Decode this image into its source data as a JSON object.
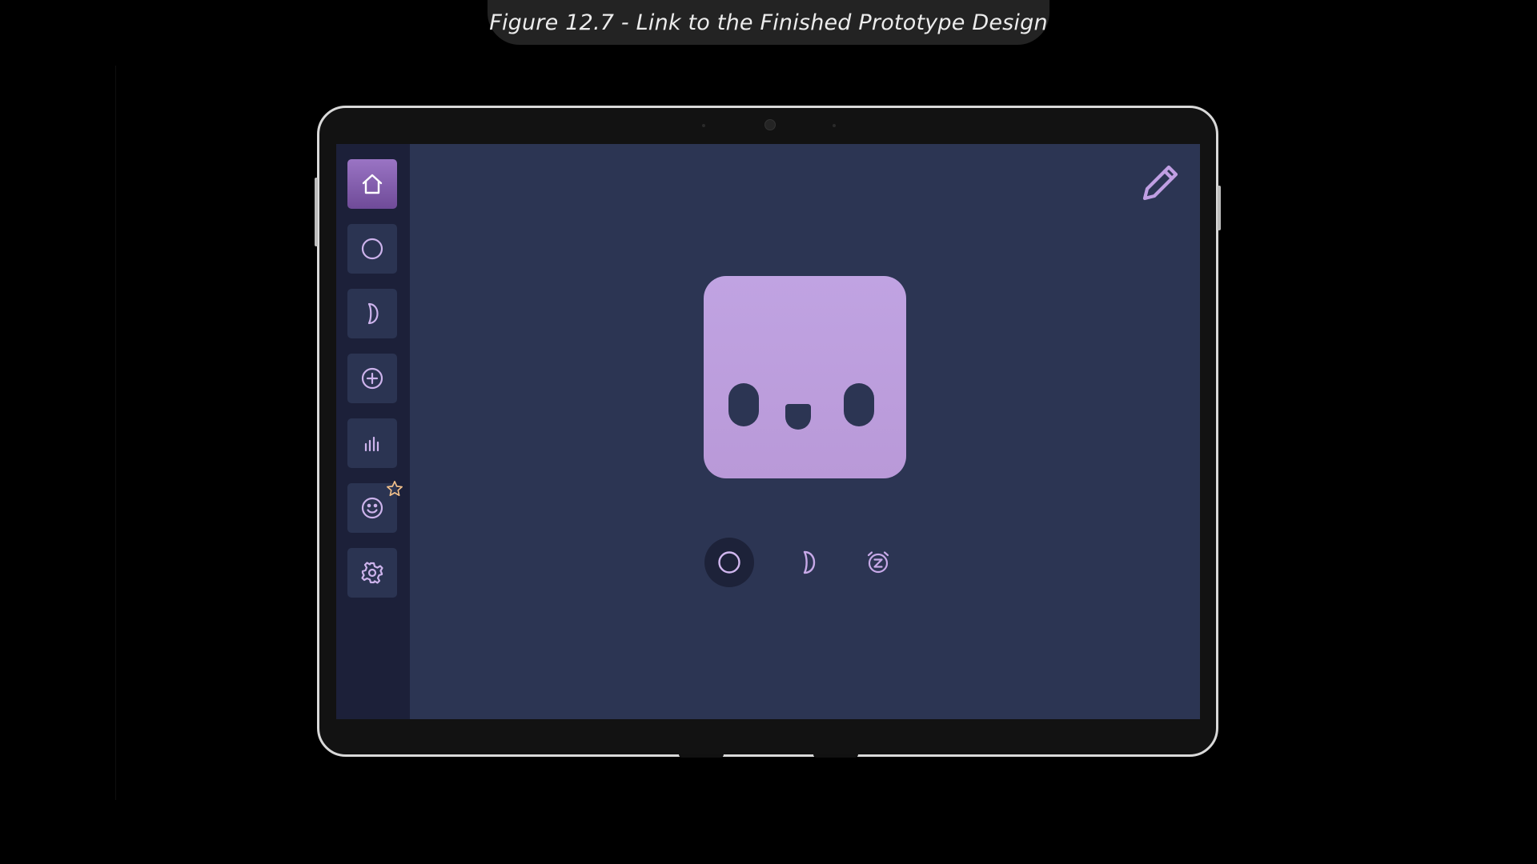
{
  "caption": "Figure 12.7 - Link to the Finished Prototype Design",
  "colors": {
    "page_background": "#000000",
    "screen_background": "#2c3553",
    "sidebar_background": "#1c2039",
    "accent": "#b99ad9",
    "active_nav": "#8a63b8",
    "star": "#f2c08a"
  },
  "sidebar": {
    "items": [
      {
        "icon": "home-icon",
        "active": true
      },
      {
        "icon": "circle-icon",
        "active": false
      },
      {
        "icon": "half-moon-icon",
        "active": false
      },
      {
        "icon": "add-circle-icon",
        "active": false
      },
      {
        "icon": "bar-chart-icon",
        "active": false
      },
      {
        "icon": "smiley-icon",
        "active": false,
        "badge": "star-icon"
      },
      {
        "icon": "gear-icon",
        "active": false
      }
    ]
  },
  "toolbar": {
    "edit_icon": "pencil-icon"
  },
  "mascot": {
    "icon": "face-avatar"
  },
  "modes": [
    {
      "icon": "circle-icon",
      "active": true
    },
    {
      "icon": "half-moon-icon",
      "active": false
    },
    {
      "icon": "alarm-clock-z-icon",
      "active": false
    }
  ]
}
